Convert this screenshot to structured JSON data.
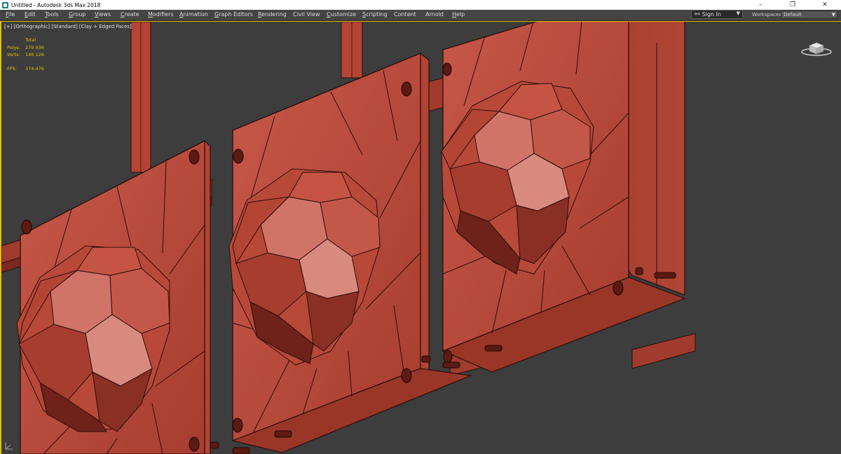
{
  "window": {
    "title": "Untitled - Autodesk 3ds Max 2018",
    "controls": {
      "minimize": "–",
      "restore": "❐",
      "close": "✕"
    }
  },
  "menu": {
    "items": [
      {
        "label": "File",
        "u": "F",
        "rest": "ile"
      },
      {
        "label": "Edit",
        "u": "E",
        "rest": "dit"
      },
      {
        "label": "Tools",
        "u": "T",
        "rest": "ools"
      },
      {
        "label": "Group",
        "u": "G",
        "rest": "roup"
      },
      {
        "label": "Views",
        "u": "V",
        "rest": "iews"
      },
      {
        "label": "Create",
        "u": "C",
        "rest": "reate"
      },
      {
        "label": "Modifiers",
        "u": "M",
        "rest": "odifiers"
      },
      {
        "label": "Animation",
        "u": "A",
        "rest": "nimation"
      },
      {
        "label": "Graph Editors",
        "u": "G",
        "rest": "raph Editors"
      },
      {
        "label": "Rendering",
        "u": "R",
        "rest": "endering"
      },
      {
        "label": "Civil View",
        "u": "",
        "rest": "Civil View"
      },
      {
        "label": "Customize",
        "u": "C",
        "rest": "ustomize"
      },
      {
        "label": "Scripting",
        "u": "S",
        "rest": "cripting"
      },
      {
        "label": "Content",
        "u": "",
        "rest": "Content"
      },
      {
        "label": "Arnold",
        "u": "",
        "rest": "Arnold"
      },
      {
        "label": "Help",
        "u": "H",
        "rest": "elp"
      }
    ]
  },
  "account": {
    "signin_label": "Sign In",
    "user_icon": "user-icon"
  },
  "workspaces": {
    "label": "Workspaces:",
    "value": "Default"
  },
  "viewport": {
    "label": "[+] [Orthographic] [Standard] [Clay + Edged Faces]",
    "stats": {
      "header": "Total",
      "polys_label": "Polys:",
      "polys_value": "279 936",
      "verts_label": "Verts:",
      "verts_value": "146 126",
      "fps_label": "FPS:",
      "fps_value": "374,476"
    },
    "viewcube_icon": "viewcube-icon",
    "colors": {
      "background": "#3d3d3d",
      "clay": "#b84838",
      "clay_light": "#c65444",
      "clay_dark": "#8a2f24",
      "edge": "#2a0e0a",
      "active_border": "#e3c200",
      "stats_text": "#e3c200"
    }
  }
}
